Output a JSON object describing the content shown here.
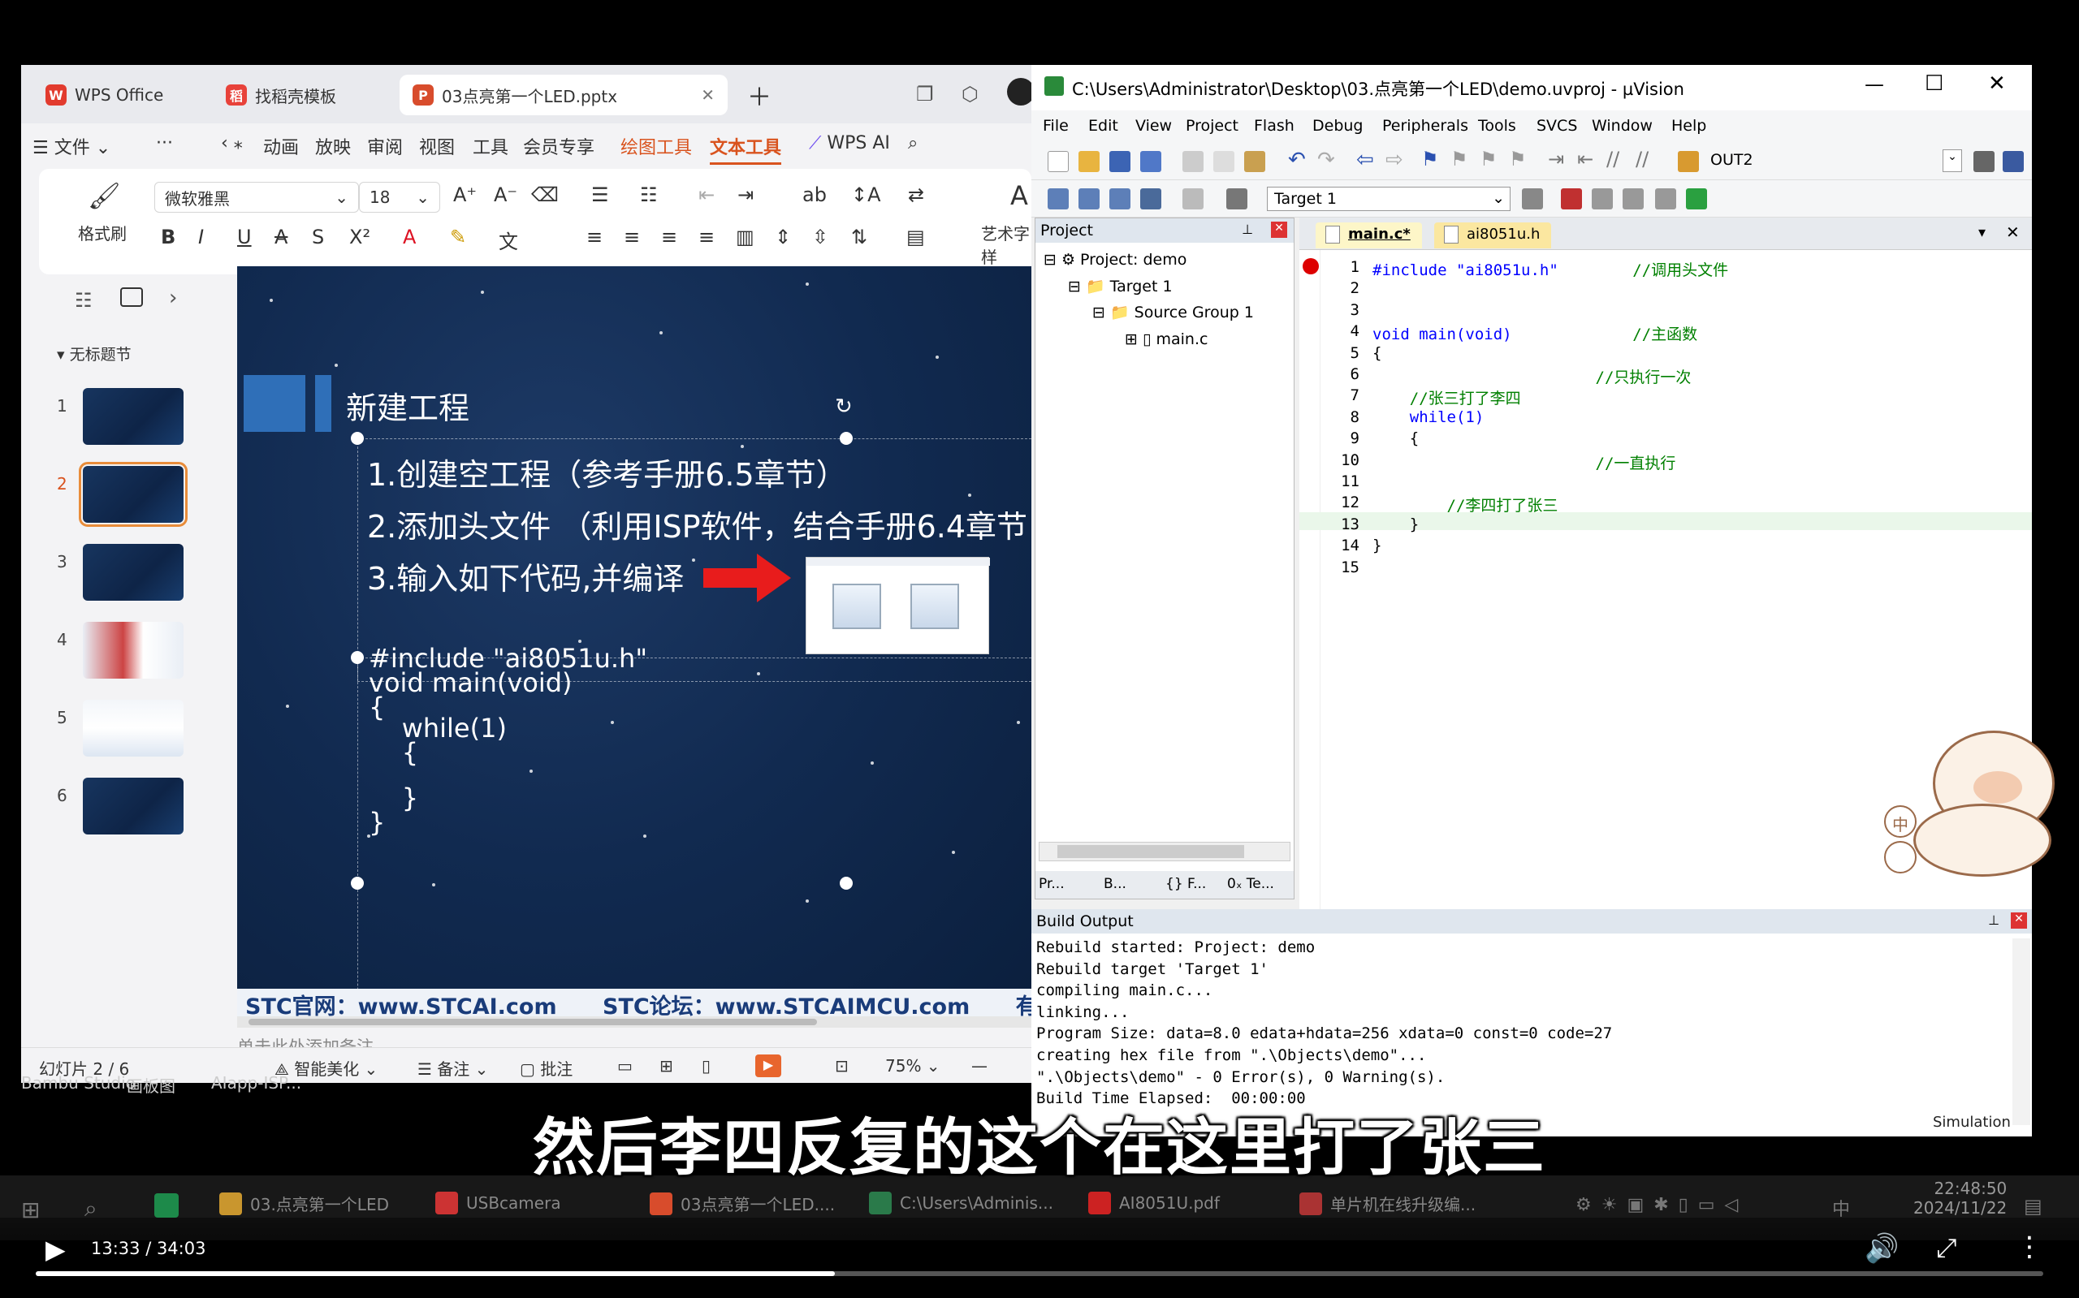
{
  "wps": {
    "tabs": [
      {
        "label": "WPS Office"
      },
      {
        "label": "找稻壳模板"
      },
      {
        "label": "03点亮第一个LED.pptx"
      }
    ],
    "menu": [
      "文件",
      "···",
      "动画",
      "放映",
      "审阅",
      "视图",
      "工具",
      "会员专享",
      "绘图工具",
      "文本工具",
      "WPS AI"
    ],
    "ribbon": {
      "format_painter": "格式刷",
      "font_name": "微软雅黑",
      "font_size": "18",
      "art_text": "艺术字样"
    },
    "section_label": "无标题节",
    "slide_numbers": [
      "1",
      "2",
      "3",
      "4",
      "5",
      "6"
    ],
    "slide": {
      "title": "新建工程",
      "lines": [
        "1.创建空工程（参考手册6.5章节）",
        "2.添加头文件 （利用ISP软件，结合手册6.4章节",
        "3.输入如下代码,并编译"
      ],
      "code": [
        "#include \"ai8051u.h\"",
        "void main(void)",
        "{",
        "    while(1)",
        "    {",
        "",
        "    }",
        "}"
      ],
      "footer": "STC官网：www.STCAI.com      STC论坛：www.STCAIMCU.com      有任何疑"
    },
    "notes_placeholder": "单击此处添加备注",
    "status": {
      "slide_count": "幻灯片 2 / 6",
      "beautify": "智能美化",
      "notes": "备注",
      "comments": "批注",
      "zoom": "75%"
    }
  },
  "uvision": {
    "title": "C:\\Users\\Administrator\\Desktop\\03.点亮第一个LED\\demo.uvproj - µVision",
    "menu": [
      "File",
      "Edit",
      "View",
      "Project",
      "Flash",
      "Debug",
      "Peripherals",
      "Tools",
      "SVCS",
      "Window",
      "Help"
    ],
    "toolbar_combo": "OUT2",
    "target_combo": "Target 1",
    "project_panel": {
      "title": "Project",
      "tree": [
        "Project: demo",
        "Target 1",
        "Source Group 1",
        "main.c"
      ],
      "tabs": [
        "Pr...",
        "B...",
        "{} F...",
        "0ₓ Te..."
      ]
    },
    "editor_tabs": [
      "main.c*",
      "ai8051u.h"
    ],
    "code_lines": [
      {
        "n": "1",
        "t": "#include \"ai8051u.h\"        //调用头文件"
      },
      {
        "n": "2",
        "t": ""
      },
      {
        "n": "3",
        "t": ""
      },
      {
        "n": "4",
        "t": "void main(void)             //主函数"
      },
      {
        "n": "5",
        "t": "{"
      },
      {
        "n": "6",
        "t": "                        //只执行一次"
      },
      {
        "n": "7",
        "t": "    //张三打了李四"
      },
      {
        "n": "8",
        "t": "    while(1)"
      },
      {
        "n": "9",
        "t": "    {"
      },
      {
        "n": "10",
        "t": "                        //一直执行"
      },
      {
        "n": "11",
        "t": ""
      },
      {
        "n": "12",
        "t": "        //李四打了张三"
      },
      {
        "n": "13",
        "t": "    }"
      },
      {
        "n": "14",
        "t": "}"
      },
      {
        "n": "15",
        "t": ""
      }
    ],
    "build_output": {
      "title": "Build Output",
      "lines": [
        "Rebuild started: Project: demo",
        "Rebuild target 'Target 1'",
        "compiling main.c...",
        "linking...",
        "Program Size: data=8.0 edata+hdata=256 xdata=0 const=0 code=27",
        "creating hex file from \".\\Objects\\demo\"...",
        "\".\\Objects\\demo\" - 0 Error(s), 0 Warning(s).",
        "Build Time Elapsed:  00:00:00"
      ],
      "mode": "Simulation"
    }
  },
  "desktop": {
    "icons": [
      "Bambu Studio",
      "画板图",
      "AIapp-ISP..."
    ]
  },
  "taskbar": {
    "apps": [
      "03.点亮第一个LED",
      "USBcamera",
      "03点亮第一个LED....",
      "C:\\Users\\Adminis...",
      "AI8051U.pdf",
      "单片机在线升级编..."
    ],
    "ime": "中",
    "time": "22:48:50",
    "date": "2024/11/22"
  },
  "video": {
    "subtitle": "然后李四反复的这个在这里打了张三",
    "time": "13:33 / 34:03",
    "progress": 0.398
  }
}
